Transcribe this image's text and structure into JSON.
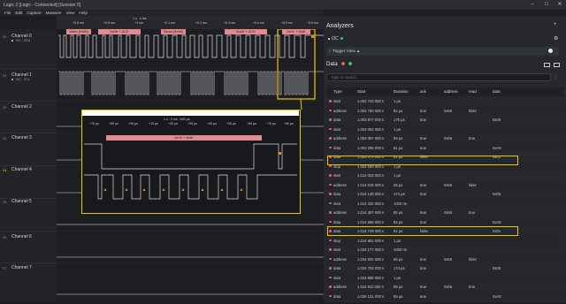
{
  "window": {
    "title": "Logic 2 [Logic - Connected] [Session 0]",
    "min": "–",
    "max": "□",
    "close": "✕"
  },
  "menu": [
    "File",
    "Edit",
    "Capture",
    "Measure",
    "View",
    "Help"
  ],
  "timebar": {
    "span_label": "1 s : 3 ms",
    "ticks": [
      "+0.8 ms",
      "+0.9 ms",
      "+1 ms",
      "+0.1 ms",
      "+0.2 ms",
      "+0.3 ms",
      "+0.4 ms",
      "+0.5 ms",
      "+0.6 ms"
    ]
  },
  "channels": [
    {
      "num": "00",
      "name": "Channel 0",
      "sub": "I2C - SDA"
    },
    {
      "num": "01",
      "name": "Channel 1",
      "sub": "I2C - SCL"
    },
    {
      "num": "02",
      "name": "Channel 2"
    },
    {
      "num": "03",
      "name": "Channel 3"
    },
    {
      "num": "04",
      "name": "Channel 4"
    },
    {
      "num": "05",
      "name": "Channel 5"
    },
    {
      "num": "06",
      "name": "Channel 6"
    },
    {
      "num": "07",
      "name": "Channel 7"
    }
  ],
  "decodes": [
    "Write [0x55]",
    "0x06 + ACK",
    "Read [0x55]",
    "0xAE + ACK",
    "0x01 + NAK"
  ],
  "zoom": {
    "span_label": "1 s : 3 ms : 500 µs",
    "ticks": [
      "+70 µs",
      "+80 µs",
      "+90 µs",
      "+10 µs",
      "+20 µs",
      "+30 µs",
      "+40 µs",
      "+50 µs",
      "+60 µs",
      "+70 µs",
      "+80 µs"
    ],
    "label": "0x01 + NAK"
  },
  "analyzers": {
    "title": "Analyzers",
    "i2c_label": "I2C",
    "trigger_view": "Trigger View ▲",
    "data_title": "Data",
    "search_placeholder": "Type to search",
    "colors": {
      "row_dot": "#e15a8a",
      "active": "#2ecc71",
      "highlight": "#f3c400"
    },
    "columns": [
      "Type",
      "Start",
      "Duration",
      "ack",
      "address",
      "read",
      "data"
    ],
    "rows": [
      [
        "start",
        "1.002 743 000 s",
        "1 µs",
        "",
        "",
        "",
        ""
      ],
      [
        "address",
        "1.002 780 000 s",
        "82 µs",
        "true",
        "0x55",
        "false",
        ""
      ],
      [
        "data",
        "1.002 877 000 s",
        "175 µs",
        "true",
        "",
        "",
        "0x06"
      ],
      [
        "start",
        "1.003 062 000 s",
        "1 µs",
        "",
        "",
        "",
        ""
      ],
      [
        "address",
        "1.003 097 000 s",
        "84 µs",
        "true",
        "0x55",
        "true",
        ""
      ],
      [
        "data",
        "1.003 299 000 s",
        "81 µs",
        "true",
        "",
        "",
        "0xAE"
      ],
      [
        "data",
        "1.003 479 000 s",
        "81 µs",
        "false",
        "",
        "",
        "0x01"
      ],
      [
        "stop",
        "1.003 580 000 s",
        "1 µs",
        "",
        "",
        "",
        ""
      ],
      [
        "start",
        "1.014 023 000 s",
        "1 µs",
        "",
        "",
        "",
        ""
      ],
      [
        "address",
        "1.014 048 000 s",
        "85 µs",
        "true",
        "0x55",
        "false",
        ""
      ],
      [
        "data",
        "1.014 148 000 s",
        "174 µs",
        "true",
        "",
        "",
        "0x06"
      ],
      [
        "start",
        "1.014 332 000 s",
        "1000 ns",
        "",
        "",
        "",
        ""
      ],
      [
        "address",
        "1.014 357 000 s",
        "85 µs",
        "true",
        "0x55",
        "true",
        ""
      ],
      [
        "data",
        "1.014 566 000 s",
        "83 µs",
        "true",
        "",
        "",
        "0xAE"
      ],
      [
        "data",
        "1.014 749 000 s",
        "81 µs",
        "false",
        "",
        "",
        "0x01"
      ],
      [
        "stop",
        "1.014 851 000 s",
        "1 µs",
        "",
        "",
        "",
        ""
      ],
      [
        "start",
        "1.024 177 000 s",
        "1000 ns",
        "",
        "",
        "",
        ""
      ],
      [
        "address",
        "1.024 602 000 s",
        "85 µs",
        "true",
        "0x55",
        "false",
        ""
      ],
      [
        "data",
        "1.024 702 000 s",
        "174 µs",
        "true",
        "",
        "",
        "0x06"
      ],
      [
        "start",
        "1.024 886 000 s",
        "1 µs",
        "",
        "",
        "",
        ""
      ],
      [
        "address",
        "1.024 911 000 s",
        "85 µs",
        "true",
        "0x55",
        "true",
        ""
      ],
      [
        "data",
        "1.025 121 000 s",
        "85 µs",
        "true",
        "",
        "",
        "0xAE"
      ]
    ]
  }
}
